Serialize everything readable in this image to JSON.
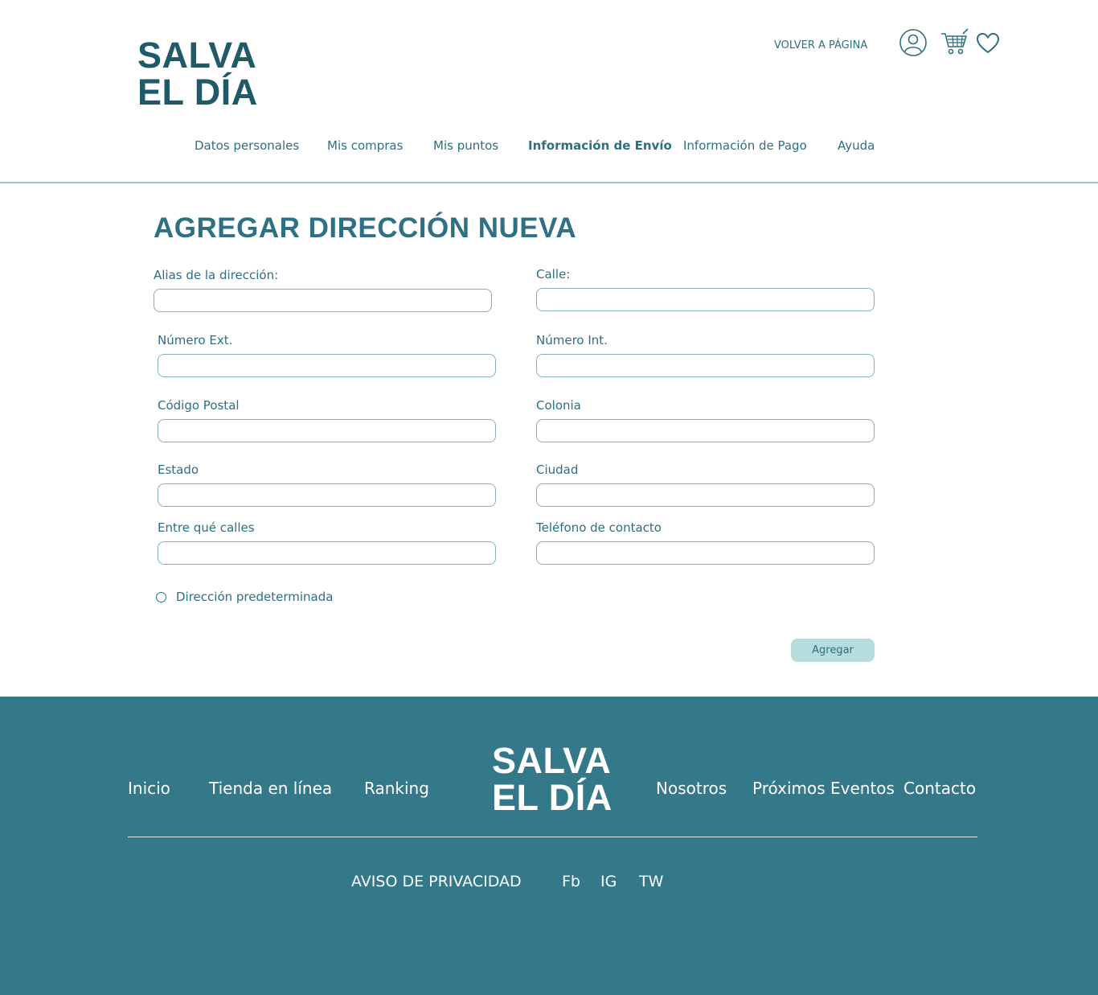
{
  "brand": {
    "line1": "SALVA",
    "line2": "EL DÍA"
  },
  "header": {
    "back_label": "VOLVER A PÁGINA",
    "icons": [
      "user-icon",
      "cart-icon",
      "heart-icon"
    ]
  },
  "nav": {
    "items": [
      {
        "label": "Datos personales"
      },
      {
        "label": "Mis compras"
      },
      {
        "label": "Mis puntos"
      },
      {
        "label": "Información de Envío",
        "active": true
      },
      {
        "label": "Información de Pago"
      },
      {
        "label": "Ayuda"
      }
    ]
  },
  "form": {
    "title": "AGREGAR DIRECCIÓN NUEVA",
    "fields": {
      "alias": {
        "label": "Alias de la dirección:",
        "value": ""
      },
      "calle": {
        "label": "Calle:",
        "value": ""
      },
      "num_ext": {
        "label": "Número Ext.",
        "value": ""
      },
      "num_int": {
        "label": "Número Int.",
        "value": ""
      },
      "codigo_postal": {
        "label": "Código Postal",
        "value": ""
      },
      "colonia": {
        "label": "Colonia",
        "value": ""
      },
      "estado": {
        "label": "Estado",
        "value": ""
      },
      "ciudad": {
        "label": "Ciudad",
        "value": ""
      },
      "entre_calles": {
        "label": "Entre qué calles",
        "value": ""
      },
      "telefono": {
        "label": "Teléfono de contacto",
        "value": ""
      }
    },
    "default_address": {
      "label": "Dirección predeterminada",
      "checked": false
    },
    "submit_label": "Agregar"
  },
  "footer": {
    "links": [
      "Inicio",
      "Tienda en línea",
      "Ranking",
      "Nosotros",
      "Próximos Eventos",
      "Contacto"
    ],
    "privacy": "AVISO DE PRIVACIDAD",
    "social": [
      "Fb",
      "IG",
      "TW"
    ]
  },
  "colors": {
    "primary": "#2e6f80",
    "logo": "#1f5a6b",
    "footer_bg": "#34798a",
    "button_bg": "#b6dcdd",
    "input_border": "#7fb3bd"
  }
}
